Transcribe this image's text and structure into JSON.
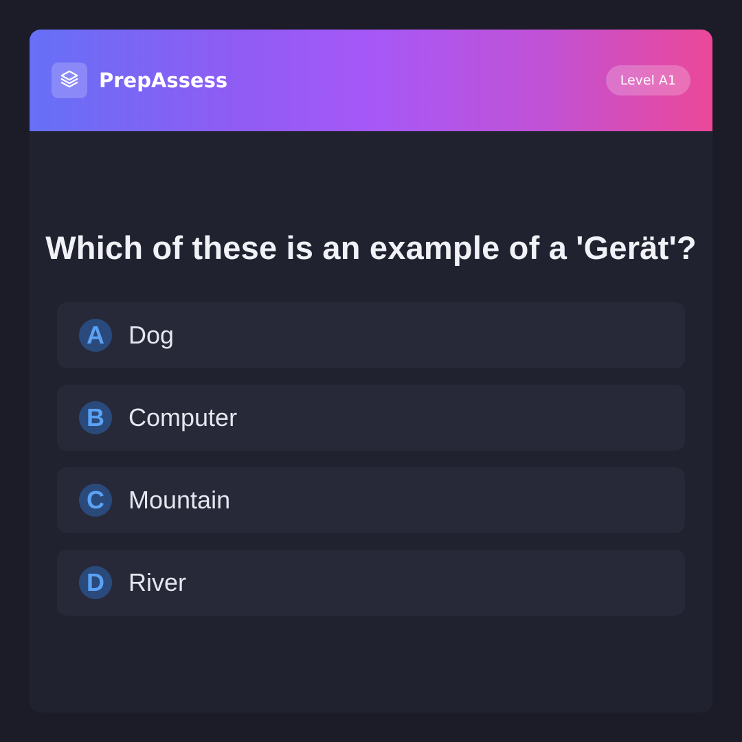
{
  "header": {
    "logo_icon": "layers-icon",
    "brand": "PrepAssess",
    "level": "Level A1"
  },
  "quiz": {
    "question": "Which of these is an example of a 'Gerät'?",
    "options": [
      {
        "letter": "A",
        "text": "Dog"
      },
      {
        "letter": "B",
        "text": "Computer"
      },
      {
        "letter": "C",
        "text": "Mountain"
      },
      {
        "letter": "D",
        "text": "River"
      }
    ]
  },
  "colors": {
    "page_background": "#1b1c27",
    "card_background": "#202230",
    "header_gradient": [
      "#6670f6",
      "#a658f7",
      "#ec4899"
    ],
    "option_background": "#272939",
    "option_letter_background": "#2b4a7c",
    "option_letter_color": "#5aa2f5"
  }
}
